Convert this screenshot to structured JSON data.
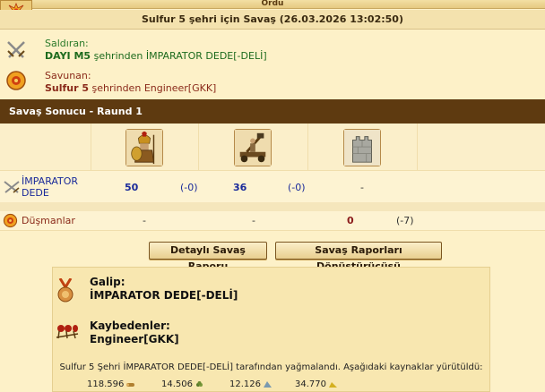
{
  "window": {
    "title": "Ordu",
    "corner_icon": "explosion-icon"
  },
  "battle": {
    "title": "Sulfur 5 şehri için Savaş (26.03.2026 13:02:50)"
  },
  "attacker": {
    "label": "Saldıran:",
    "city": "DAYI M5",
    "from_text": " şehrinden ",
    "player": "İMPARATOR DEDE[-DELİ]",
    "icon": "crossed-swords-icon"
  },
  "defender": {
    "label": "Savunan:",
    "city": "Sulfur 5",
    "from_text": " şehrinden ",
    "player": "Engineer[GKK]",
    "icon": "shield-icon"
  },
  "result": {
    "header": "Savaş Sonucu - Raund 1",
    "units": [
      {
        "name": "hoplite",
        "icon": "hoplite-icon"
      },
      {
        "name": "catapult",
        "icon": "catapult-icon"
      },
      {
        "name": "wall",
        "icon": "wall-icon"
      }
    ],
    "rows": [
      {
        "name": "İMPARATOR DEDE",
        "icon": "crossed-swords-icon",
        "cells": [
          {
            "value": "50",
            "loss": "(-0)"
          },
          {
            "value": "36",
            "loss": "(-0)"
          },
          {
            "value": "-",
            "loss": ""
          }
        ]
      },
      {
        "name": "Düşmanlar",
        "icon": "shield-icon",
        "cells": [
          {
            "value": "-",
            "loss": ""
          },
          {
            "value": "-",
            "loss": ""
          },
          {
            "value": "0",
            "loss": "(-7)"
          }
        ]
      }
    ]
  },
  "buttons": {
    "detailed_report": "Detaylı Savaş Raporu",
    "report_converter": "Savaş Raporları Dönüştürücüsü"
  },
  "summary": {
    "winner_label": "Galip:",
    "winner": "İMPARATOR DEDE[-DELİ]",
    "loser_label": "Kaybedenler:",
    "loser": "Engineer[GKK]",
    "plunder_text": "Sulfur 5 Şehri İMPARATOR DEDE[-DELİ] tarafından yağmalandı. Aşağıdaki kaynaklar yürütüldü:",
    "resources": [
      {
        "amount": "118.596",
        "icon": "wood-icon",
        "color": "#b08030"
      },
      {
        "amount": "14.506",
        "icon": "wine-icon",
        "color": "#5a7a2a"
      },
      {
        "amount": "12.126",
        "icon": "marble-icon",
        "color": "#7a9ab0"
      },
      {
        "amount": "34.770",
        "icon": "sulfur-icon",
        "color": "#d4b020"
      }
    ]
  }
}
